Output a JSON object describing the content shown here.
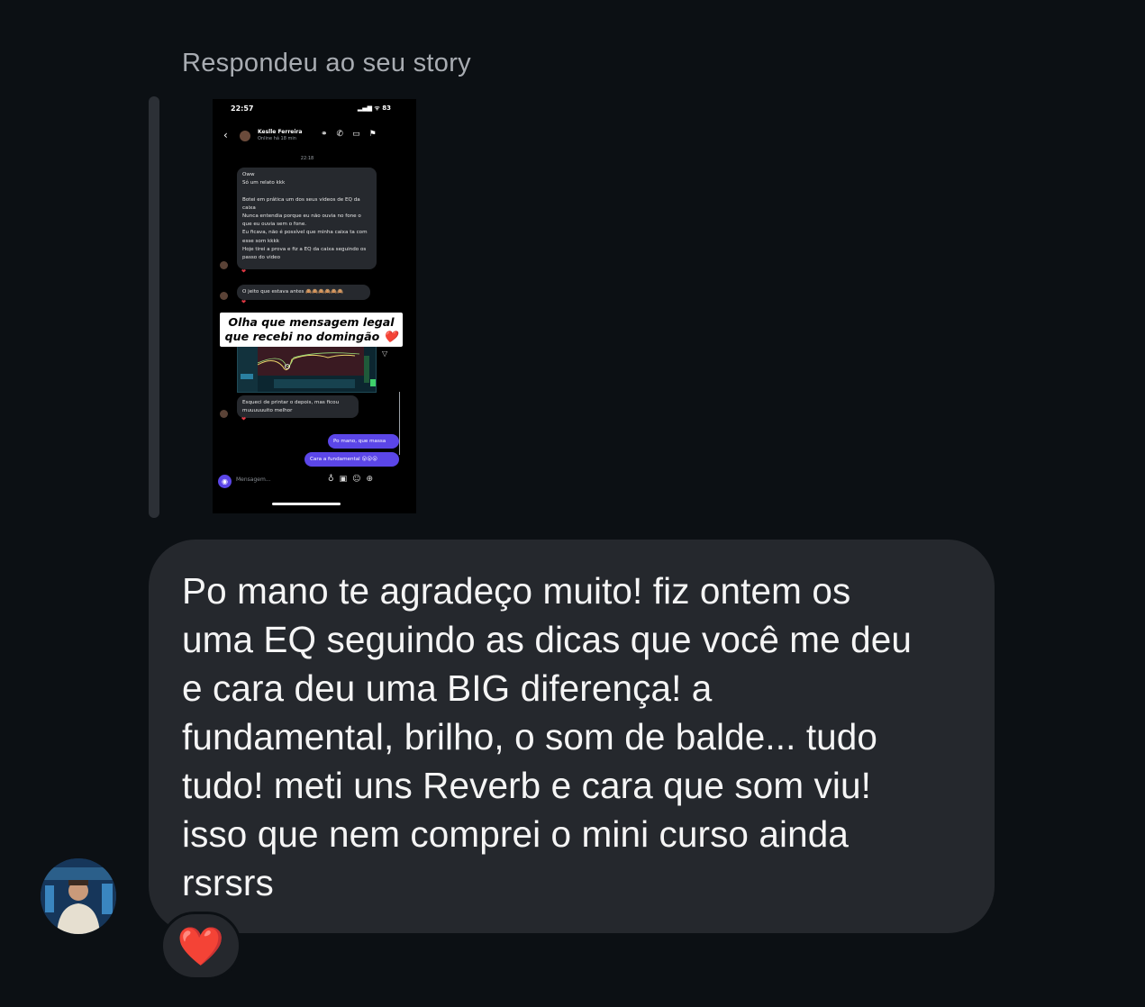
{
  "reply_label": "Respondeu ao seu story",
  "story": {
    "status_time": "22:57",
    "status_right": "▂▄▆ ᯤ 83",
    "contact_name": "Keslle Ferreira",
    "contact_status": "Online há 18 min",
    "timestamp": "22:18",
    "messages": [
      {
        "text": "Oww\nSó um relato kkk\n\nBotei em prática um dos seus videos de EQ da caixa\nNunca entendia porque eu não ouvia no fone o que eu ouvia sem o fone.\nEu ficava, não é possível que minha caixa ta com esse som kkkk\nHoje tirei a prova e fiz a EQ da caixa seguindo os passo do video"
      },
      {
        "text": "O jeito que estava antes 🙈🙈🙈🙈🙈🙈"
      },
      {
        "text": "Esqueci de printar o depois, mas ficou muuuuuuito melhor"
      },
      {
        "text": "Po mano, que massa"
      },
      {
        "text": "Cara a fundamental 😮😮😮"
      }
    ],
    "overlay_text": "Olha que mensagem legal\nque recebi no domingão ❤️",
    "input_placeholder": "Mensagem..."
  },
  "message": {
    "text": "Po mano te agradeço muito! fiz ontem os\numa EQ seguindo as dicas que você me deu\ne cara deu uma BIG diferença! a\nfundamental, brilho, o som de balde... tudo\ntudo! meti uns Reverb e cara que som viu!\nisso que nem comprei o mini curso ainda\nrsrsrs"
  },
  "reaction": "❤️",
  "colors": {
    "background": "#0c1014",
    "bubble": "#25282d",
    "accent": "#5b46e8"
  }
}
